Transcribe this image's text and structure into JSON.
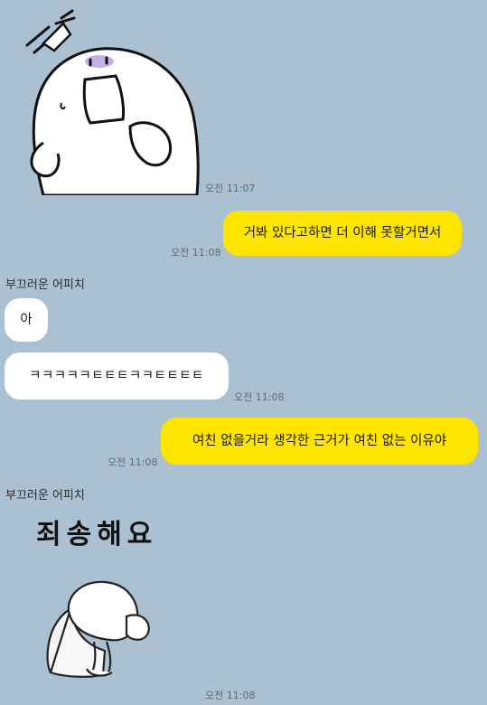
{
  "messages": [
    {
      "type": "sticker",
      "side": "received",
      "sticker": "surprised-ghost-sticker",
      "time": "오전 11:07"
    },
    {
      "type": "text",
      "side": "sent",
      "text": "거봐 있다고하면 더 이해 못할거면서",
      "time": "오전 11:08"
    },
    {
      "type": "sender",
      "name": "부끄러운 어피치"
    },
    {
      "type": "text",
      "side": "received",
      "text": "아"
    },
    {
      "type": "text",
      "side": "received",
      "text": "ㅋㅋㅋㅋㅋㅌㅌㅌㅋㅋㅌㅌㅌㅌ",
      "time": "오전 11:08"
    },
    {
      "type": "text",
      "side": "sent",
      "text": "여친 없을거라 생각한 근거가 여친 없는 이유야",
      "time": "오전 11:08"
    },
    {
      "type": "sender",
      "name": "부끄러운 어피치"
    },
    {
      "type": "sticker",
      "side": "received",
      "sticker": "bowing-ghost-sticker",
      "caption": "죄송해요",
      "time": "오전 11:08"
    }
  ],
  "colors": {
    "background": "#abc1d1",
    "sent_bubble": "#fee500",
    "received_bubble": "#ffffff",
    "timestamp": "#5d6a74"
  }
}
